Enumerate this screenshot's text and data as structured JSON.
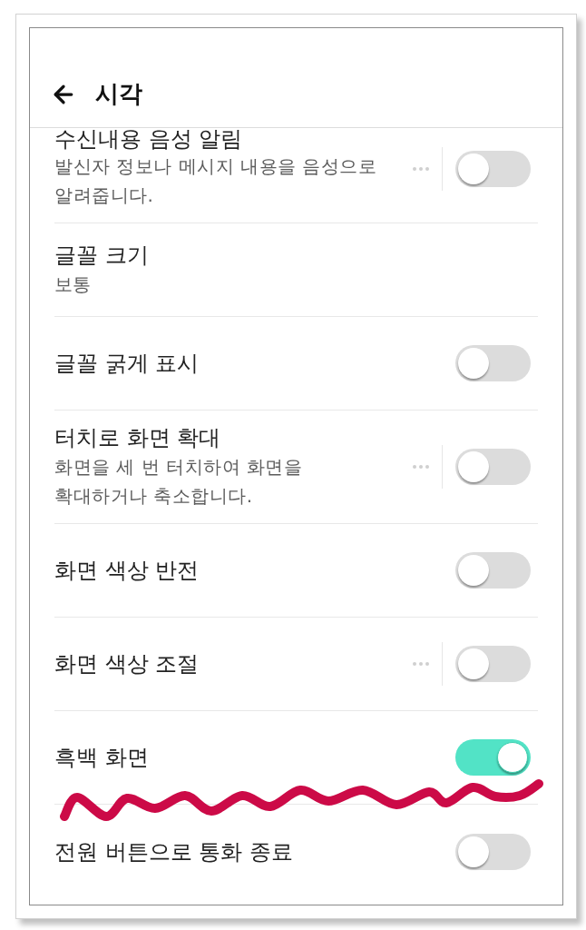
{
  "header": {
    "title": "시각"
  },
  "rows": [
    {
      "kind": "toggle",
      "title": "수신내용 음성 알림",
      "description": [
        "발신자 정보나 메시지 내용을 음성으로",
        "알려줍니다."
      ],
      "more": true,
      "on": false
    },
    {
      "kind": "value",
      "title": "글꼴 크기",
      "value": "보통"
    },
    {
      "kind": "toggle",
      "title": "글꼴 굵게 표시",
      "more": false,
      "on": false
    },
    {
      "kind": "toggle",
      "title": "터치로 화면 확대",
      "description": [
        "화면을 세 번 터치하여 화면을",
        "확대하거나 축소합니다."
      ],
      "more": true,
      "on": false
    },
    {
      "kind": "toggle",
      "title": "화면 색상 반전",
      "more": false,
      "on": false
    },
    {
      "kind": "toggle",
      "title": "화면 색상 조절",
      "more": true,
      "on": false
    },
    {
      "kind": "toggle",
      "title": "흑백 화면",
      "more": false,
      "on": true
    },
    {
      "kind": "toggle",
      "title": "전원 버튼으로 통화 종료",
      "more": false,
      "on": false
    }
  ]
}
